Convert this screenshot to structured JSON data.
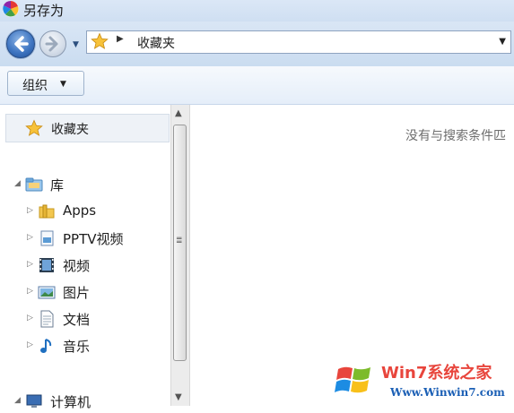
{
  "window": {
    "title": "另存为"
  },
  "nav": {
    "breadcrumb_text": "收藏夹",
    "icons": {
      "back": "back-arrow-icon",
      "forward": "forward-arrow-icon",
      "location": "star-icon",
      "history_dropdown": "chevron-down-icon"
    }
  },
  "toolbar": {
    "organize_label": "组织"
  },
  "sidebar": {
    "favorites_label": "收藏夹",
    "library_label": "库",
    "items": [
      {
        "label": "Apps",
        "icon": "folder-icon"
      },
      {
        "label": "PPTV视频",
        "icon": "document-icon"
      },
      {
        "label": "视频",
        "icon": "video-icon"
      },
      {
        "label": "图片",
        "icon": "picture-icon"
      },
      {
        "label": "文档",
        "icon": "document-icon"
      },
      {
        "label": "音乐",
        "icon": "music-icon"
      }
    ],
    "computer_label": "计算机"
  },
  "content": {
    "empty_message": "没有与搜索条件匹"
  },
  "watermark": {
    "brand": "Win7系统之家",
    "url": "Www.Winwin7.com"
  }
}
